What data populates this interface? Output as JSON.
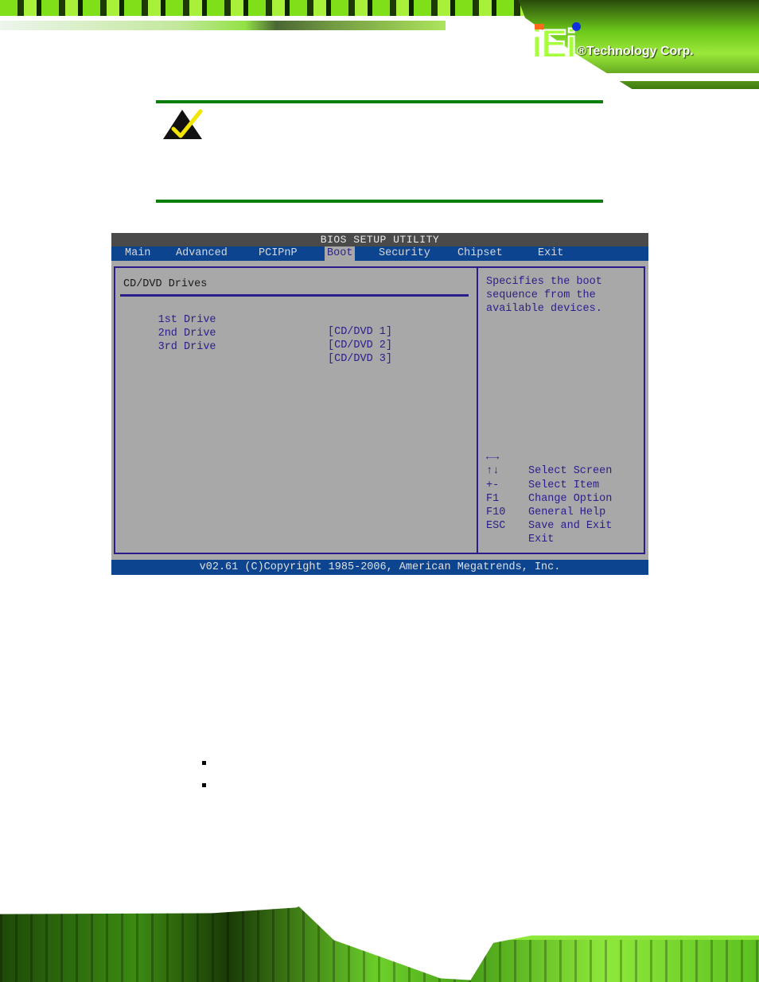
{
  "header": {
    "logo_mark": "iEi",
    "logo_text": "®Technology Corp."
  },
  "note": {
    "icon": "note-checkmark-icon",
    "colors": {
      "rule": "#0a7e0a",
      "check": "#f2e600",
      "triangle": "#111111"
    }
  },
  "bios": {
    "title": "BIOS SETUP UTILITY",
    "tabs": [
      {
        "label": "Main",
        "active": false
      },
      {
        "label": "Advanced",
        "active": false
      },
      {
        "label": "PCIPnP",
        "active": false
      },
      {
        "label": "Boot",
        "active": true
      },
      {
        "label": "Security",
        "active": false
      },
      {
        "label": "Chipset",
        "active": false
      },
      {
        "label": "Exit",
        "active": false
      }
    ],
    "section_title": "CD/DVD Drives",
    "items": [
      {
        "label": "1st Drive",
        "value": "[CD/DVD 1]"
      },
      {
        "label": "2nd Drive",
        "value": "[CD/DVD 2]"
      },
      {
        "label": "3rd Drive",
        "value": "[CD/DVD 3]"
      }
    ],
    "help_text": "Specifies the boot\nsequence from the\navailable devices.",
    "keys": [
      {
        "key": "←→",
        "desc": "Select Screen"
      },
      {
        "key": "↑↓",
        "desc": "Select Item"
      },
      {
        "key": "+-",
        "desc": "Change Option"
      },
      {
        "key": "F1",
        "desc": "General Help"
      },
      {
        "key": "F10",
        "desc": "Save and Exit"
      },
      {
        "key": "ESC",
        "desc": "Exit"
      }
    ],
    "footer": "v02.61 (C)Copyright 1985-2006, American Megatrends, Inc.",
    "colors": {
      "title_bar": "#4a4a4a",
      "menu_bar": "#0c4490",
      "body": "#a8a8a8",
      "text": "#2a1e8a"
    }
  },
  "bullets": [
    {
      "text": ""
    },
    {
      "text": ""
    }
  ]
}
